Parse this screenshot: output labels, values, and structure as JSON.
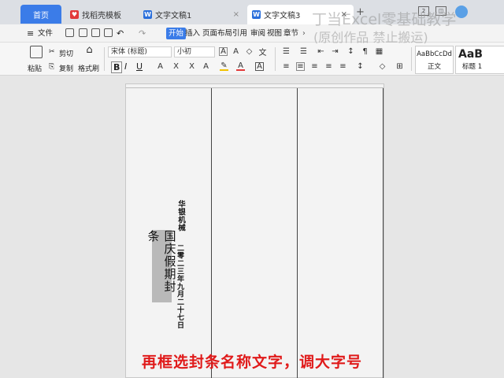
{
  "tabs": {
    "home": "首页",
    "template": "找稻壳模板",
    "doc1": "文字文稿1",
    "doc3": "文字文稿3",
    "close": "×",
    "new": "+"
  },
  "menu": {
    "file": "文件",
    "start": "开始",
    "insert": "插入",
    "layout": "页面布局",
    "reference": "引用",
    "review": "审阅",
    "view": "视图",
    "chapter": "章节"
  },
  "ribbon": {
    "paste": "粘贴",
    "cut": "剪切",
    "copy": "复制",
    "format_painter": "格式刷",
    "font_name": "宋体 (标题)",
    "font_size": "小初",
    "bold": "B",
    "italic": "I",
    "underline": "U",
    "style_normal_sample": "AaBbCcDd",
    "style_normal": "正文",
    "style_heading_sample": "AaB",
    "style_heading": "标题 1"
  },
  "document": {
    "company": "华银机械",
    "date": "二零二三年九月二十七日",
    "seal_title": "国庆假期封条"
  },
  "overlay": {
    "watermark_line1": "丁当Excel零基础教学",
    "watermark_line2": "(原创作品 禁止搬运)",
    "caption": "再框选封条名称文字，调大字号"
  },
  "colors": {
    "accent": "#3b7ce8",
    "caption": "#e01a1a",
    "seal_highlight": "#b9b9b9"
  }
}
